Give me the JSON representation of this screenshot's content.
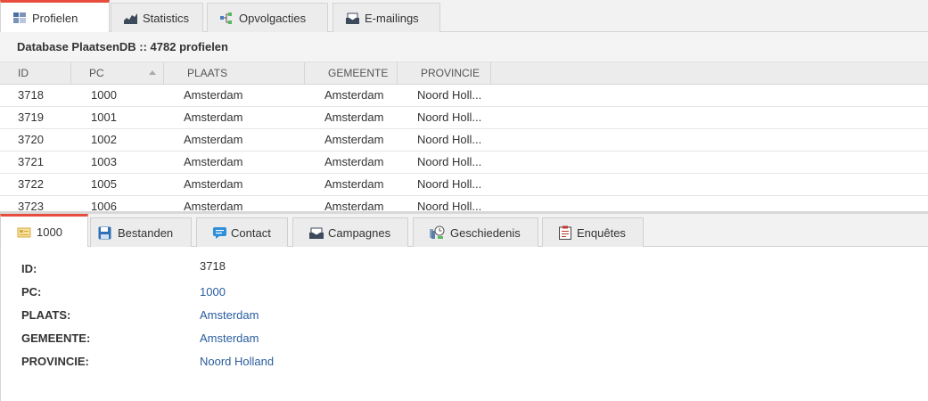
{
  "top_tabs": [
    {
      "label": "Profielen",
      "icon": "grid-icon",
      "active": true
    },
    {
      "label": "Statistics",
      "icon": "area-chart-icon",
      "active": false
    },
    {
      "label": "Opvolgacties",
      "icon": "flow-icon",
      "active": false
    },
    {
      "label": "E-mailings",
      "icon": "mail-tray-icon",
      "active": false
    }
  ],
  "database_title": "Database PlaatsenDB :: 4782 profielen",
  "grid": {
    "columns": [
      "ID",
      "PC",
      "PLAATS",
      "GEMEENTE",
      "PROVINCIE"
    ],
    "sorted_column": "PC",
    "rows": [
      [
        "3718",
        "1000",
        "Amsterdam",
        "Amsterdam",
        "Noord Holl..."
      ],
      [
        "3719",
        "1001",
        "Amsterdam",
        "Amsterdam",
        "Noord Holl..."
      ],
      [
        "3720",
        "1002",
        "Amsterdam",
        "Amsterdam",
        "Noord Holl..."
      ],
      [
        "3721",
        "1003",
        "Amsterdam",
        "Amsterdam",
        "Noord Holl..."
      ],
      [
        "3722",
        "1005",
        "Amsterdam",
        "Amsterdam",
        "Noord Holl..."
      ],
      [
        "3723",
        "1006",
        "Amsterdam",
        "Amsterdam",
        "Noord Holl..."
      ]
    ]
  },
  "detail_tabs": [
    {
      "label": "1000",
      "icon": "card-icon",
      "active": true
    },
    {
      "label": "Bestanden",
      "icon": "save-icon",
      "active": false
    },
    {
      "label": "Contact",
      "icon": "chat-bubble-icon",
      "active": false
    },
    {
      "label": "Campagnes",
      "icon": "mail-tray-icon",
      "active": false
    },
    {
      "label": "Geschiedenis",
      "icon": "history-icon",
      "active": false
    },
    {
      "label": "Enquêtes",
      "icon": "clipboard-icon",
      "active": false
    }
  ],
  "detail": {
    "fields": [
      {
        "label": "ID:",
        "value": "3718"
      },
      {
        "label": "PC:",
        "value": "1000"
      },
      {
        "label": "PLAATS:",
        "value": "Amsterdam"
      },
      {
        "label": "GEMEENTE:",
        "value": "Amsterdam"
      },
      {
        "label": "PROVINCIE:",
        "value": "Noord Holland"
      }
    ]
  },
  "colors": {
    "active_tab_accent": "#e74c3c",
    "link_value": "#2a5d9f"
  }
}
